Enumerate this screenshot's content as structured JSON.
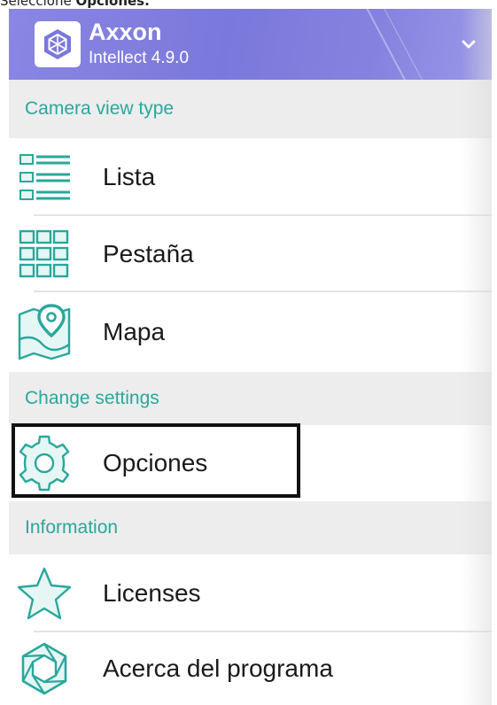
{
  "caption": {
    "prefix": "Seleccione ",
    "emphasis": "Opciones."
  },
  "header": {
    "brand_title": "Axxon",
    "brand_subtitle": "Intellect 4.9.0",
    "logo_icon": "axxon-logo-icon",
    "toggle_icon": "chevron-down-icon",
    "gradient_colors": [
      "#8a86e2",
      "#7b78dc",
      "#9a98e8"
    ]
  },
  "sections": {
    "camera_view_type": "Camera view type",
    "change_settings": "Change settings",
    "information": "Information"
  },
  "items": {
    "lista": "Lista",
    "pestana": "Pestaña",
    "mapa": "Mapa",
    "opciones": "Opciones",
    "licenses": "Licenses",
    "acerca": "Acerca del programa"
  },
  "colors": {
    "accent": "#2aa79b",
    "section_background": "#ededed",
    "highlight_border": "#111111"
  }
}
